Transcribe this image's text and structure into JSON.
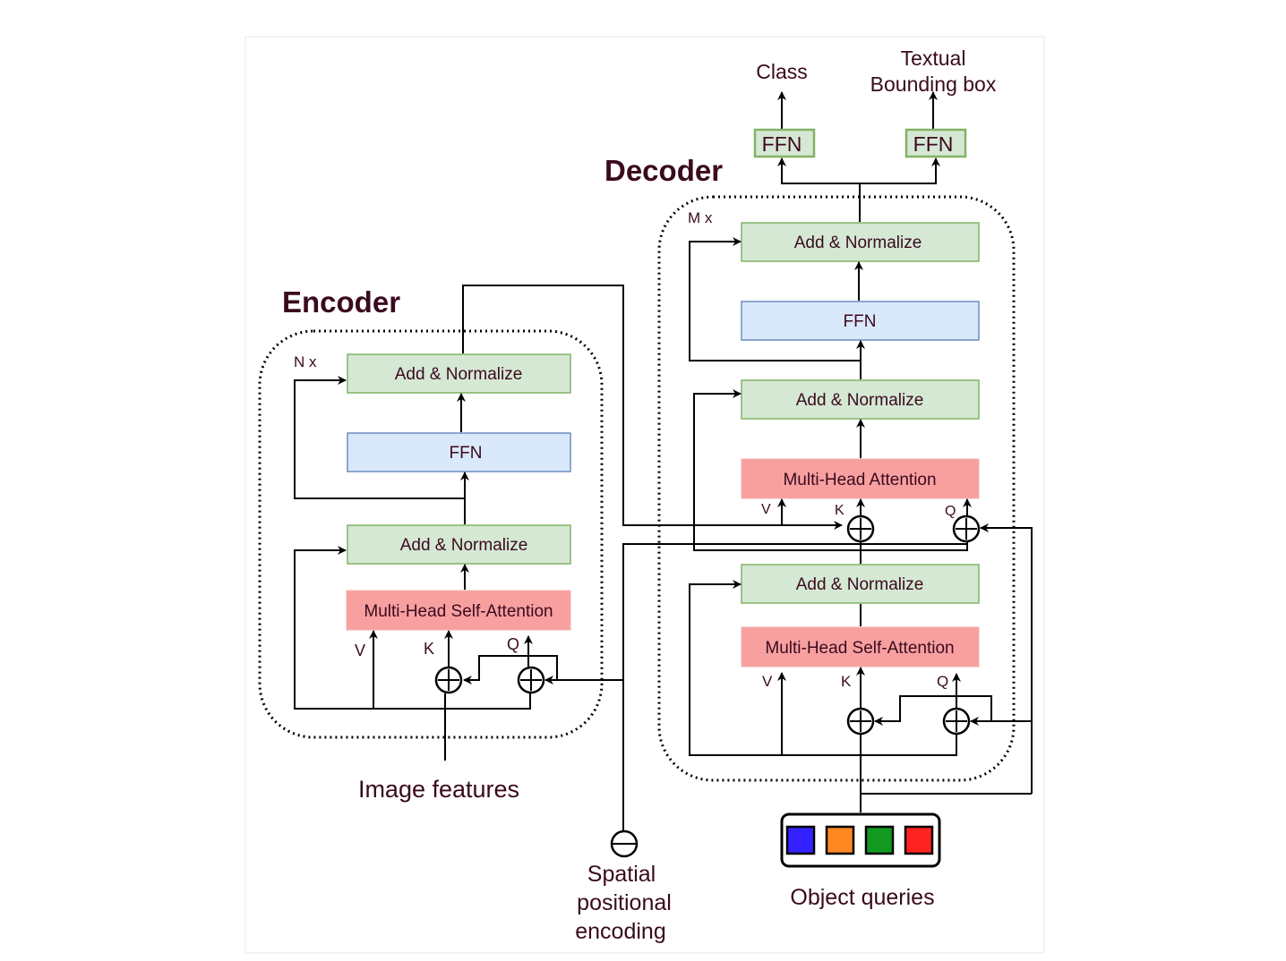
{
  "encoder": {
    "title": "Encoder",
    "repeat": "N x",
    "blocks": {
      "add_norm_top": "Add  &  Normalize",
      "ffn": "FFN",
      "add_norm_bottom": "Add  &  Normalize",
      "self_attention": "Multi-Head Self-Attention"
    },
    "inputs": {
      "v": "V",
      "k": "K",
      "q": "Q"
    },
    "input_label": "Image features"
  },
  "decoder": {
    "title": "Decoder",
    "repeat": "M x",
    "blocks": {
      "add_norm_top": "Add  &  Normalize",
      "ffn": "FFN",
      "add_norm_mid": "Add  &  Normalize",
      "cross_attention": "Multi-Head Attention",
      "add_norm_bottom": "Add  &  Normalize",
      "self_attention": "Multi-Head Self-Attention"
    },
    "cross_inputs": {
      "v": "V",
      "k": "K",
      "q": "Q"
    },
    "self_inputs": {
      "v": "V",
      "k": "K",
      "q": "Q"
    }
  },
  "heads": {
    "class_ffn": "FFN",
    "bbox_ffn": "FFN",
    "class_label": "Class",
    "bbox_label_line1": "Textual",
    "bbox_label_line2": "Bounding box"
  },
  "spatial_encoding": {
    "line1": "Spatial",
    "line2": "positional",
    "line3": "encoding"
  },
  "object_queries": {
    "label": "Object queries",
    "colors": [
      "#3322ff",
      "#ff8822",
      "#119922",
      "#ff2222"
    ]
  },
  "colors": {
    "add_norm_fill": "#d5e8d4",
    "ffn_fill": "#dae8fc",
    "attention_fill": "#f8a0a0",
    "text": "#3a0a1e"
  }
}
